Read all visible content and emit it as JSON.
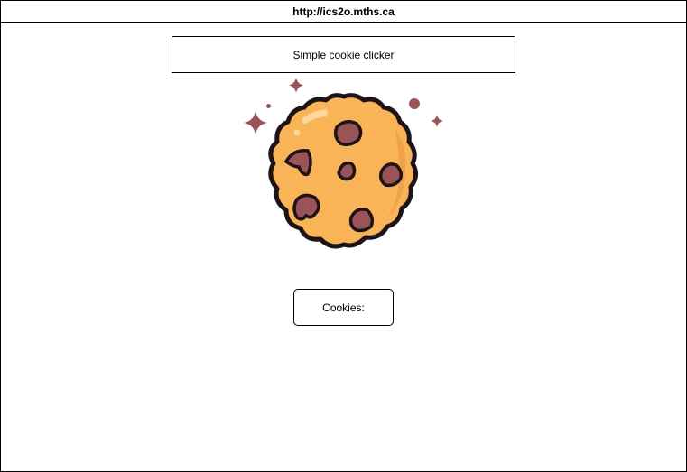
{
  "browser": {
    "url": "http://ics2o.mths.ca"
  },
  "page": {
    "title": "Simple cookie clicker",
    "counter_label": "Cookies:"
  },
  "cookie": {
    "icon": "cookie-icon",
    "colors": {
      "dough": "#F9B458",
      "dough_shade": "#F0A24A",
      "outline": "#1E1316",
      "chips": "#9A5458",
      "sparkle": "#9A5458",
      "highlight": "#FCD79C"
    }
  }
}
